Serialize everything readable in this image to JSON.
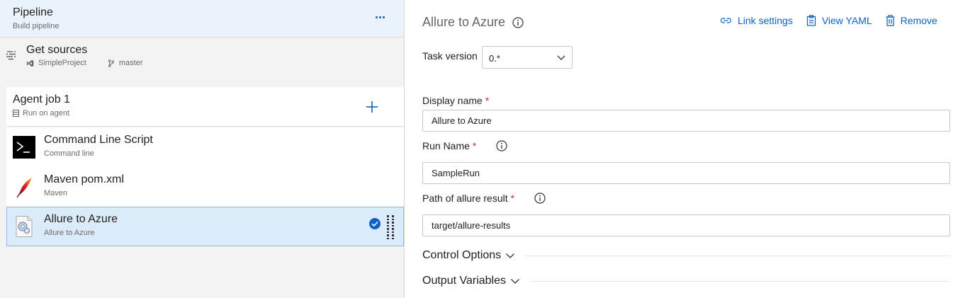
{
  "pipeline": {
    "title": "Pipeline",
    "subtitle": "Build pipeline",
    "more_icon": "ellipsis-icon"
  },
  "get_sources": {
    "title": "Get sources",
    "repo": "SimpleProject",
    "branch": "master"
  },
  "agent_job": {
    "title": "Agent job 1",
    "subtitle": "Run on agent"
  },
  "tasks": [
    {
      "title": "Command Line Script",
      "subtitle": "Command line",
      "icon": "terminal-icon"
    },
    {
      "title": "Maven pom.xml",
      "subtitle": "Maven",
      "icon": "maven-feather-icon"
    },
    {
      "title": "Allure to Azure",
      "subtitle": "Allure to Azure",
      "icon": "allure-gear-icon",
      "selected": true
    }
  ],
  "detail": {
    "title": "Allure to Azure",
    "actions": {
      "link_settings": "Link settings",
      "view_yaml": "View YAML",
      "remove": "Remove"
    },
    "task_version": {
      "label": "Task version",
      "value": "0.*"
    },
    "display_name": {
      "label": "Display name",
      "required": "*",
      "value": "Allure to Azure"
    },
    "run_name": {
      "label": "Run Name",
      "required": "*",
      "value": "SampleRun"
    },
    "allure_path": {
      "label": "Path of allure result",
      "required": "*",
      "value": "target/allure-results"
    },
    "sections": {
      "control_options": "Control Options",
      "output_variables": "Output Variables"
    }
  },
  "colors": {
    "accent": "#0b62c4",
    "selected_bg": "#dcebfa",
    "required": "#c4314b",
    "pane_bg": "#f3f3f3"
  }
}
